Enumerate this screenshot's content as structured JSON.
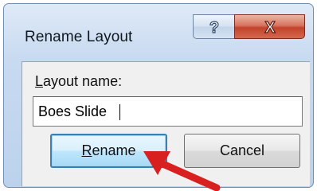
{
  "dialog": {
    "title": "Rename Layout",
    "help_glyph": "?",
    "close_glyph": "X"
  },
  "form": {
    "label_accesskey": "L",
    "label_rest": "ayout name:",
    "input_value": "Boes Slide"
  },
  "buttons": {
    "rename_accesskey": "R",
    "rename_rest": "ename",
    "cancel_label": "Cancel"
  },
  "colors": {
    "arrow": "#d92020",
    "close_button": "#c2422a",
    "default_button_border": "#3c7fb1"
  }
}
